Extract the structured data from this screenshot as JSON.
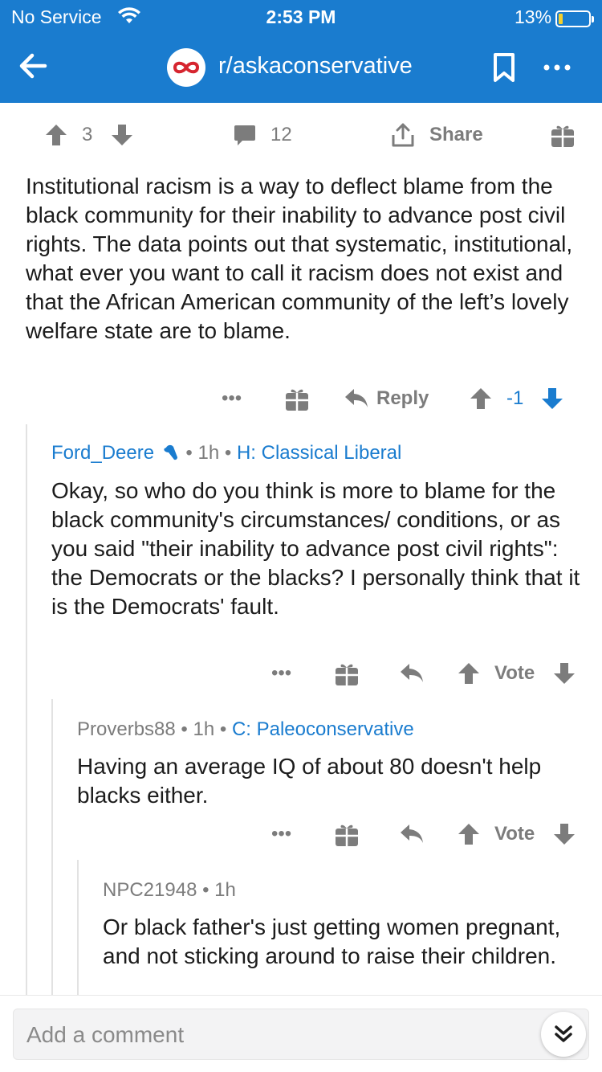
{
  "status_bar": {
    "carrier": "No Service",
    "time": "2:53 PM",
    "battery": "13%",
    "battery_level": 0.13
  },
  "header": {
    "subreddit": "r/askaconservative"
  },
  "post_actions": {
    "upvotes": "3",
    "comments": "12",
    "share_label": "Share"
  },
  "root_comment": {
    "text": "Institutional racism is a way to deflect blame from the black community for their inability to advance post civil rights. The data points out that systematic, institutional, what ever you want to call it racism does not exist and that the African American community of the left’s lovely welfare state are to blame.",
    "reply_label": "Reply",
    "score": "-1"
  },
  "comments": [
    {
      "user": "Ford_Deere",
      "sep1": "•",
      "time": "1h",
      "sep2": "•",
      "flair": "H: Classical Liberal",
      "text": "Okay, so who do you think is more to blame for the black community's circumstances/ conditions, or as you said \"their inability to advance post civil rights\": the Democrats or the blacks? I personally think that it is the Democrats' fault.",
      "vote_label": "Vote"
    },
    {
      "user": "Proverbs88",
      "sep1": "•",
      "time": "1h",
      "sep2": "•",
      "flair": "C: Paleoconservative",
      "text": "Having an average IQ of about 80 doesn't help blacks either.",
      "vote_label": "Vote"
    },
    {
      "user": "NPC21948",
      "sep1": "•",
      "time": "1h",
      "text": "Or black father's just getting women pregnant, and not sticking around to raise their children."
    }
  ],
  "composer": {
    "placeholder": "Add a comment"
  },
  "more_dots": "•••",
  "colors": {
    "header_blue": "#1a7ccf",
    "vote_blue": "#1a7ccf",
    "text_gray": "#7c7c7c"
  },
  "icons": [
    "wifi-icon",
    "back-arrow-icon",
    "subreddit-icon",
    "bookmark-icon",
    "more-icon",
    "upvote-icon",
    "downvote-icon",
    "comment-icon",
    "share-icon",
    "gift-icon",
    "reply-icon",
    "jump-down-icon"
  ]
}
